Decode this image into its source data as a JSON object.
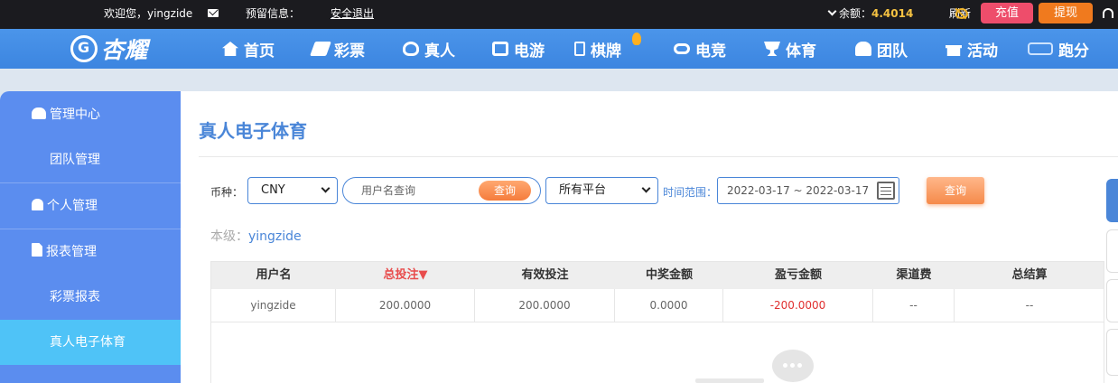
{
  "topbar": {
    "welcome": "欢迎您，yingzide",
    "message_label": "预留信息：",
    "logout": "安全退出",
    "balance_label": "余额：",
    "balance_value": "4.4014",
    "refresh": "刷新",
    "recharge": "充值",
    "withdraw": "提现"
  },
  "brand": {
    "name": "杏耀"
  },
  "nav": [
    {
      "label": "首页",
      "icon": "home-icon"
    },
    {
      "label": "彩票",
      "icon": "lottery-icon"
    },
    {
      "label": "真人",
      "icon": "live-dealer-icon"
    },
    {
      "label": "电游",
      "icon": "slot-machine-icon"
    },
    {
      "label": "棋牌",
      "icon": "chess-card-icon"
    },
    {
      "label": "电竞",
      "icon": "gamepad-icon"
    },
    {
      "label": "体育",
      "icon": "trophy-icon"
    },
    {
      "label": "团队",
      "icon": "team-icon"
    },
    {
      "label": "活动",
      "icon": "gift-icon"
    },
    {
      "label": "跑分",
      "icon": "run-points-icon"
    }
  ],
  "sidebar": [
    {
      "label": "管理中心",
      "type": "group",
      "icon": "team-icon"
    },
    {
      "label": "团队管理",
      "type": "sub"
    },
    {
      "label": "个人管理",
      "type": "group",
      "icon": "person-icon"
    },
    {
      "label": "报表管理",
      "type": "group",
      "icon": "report-icon"
    },
    {
      "label": "彩票报表",
      "type": "sub"
    },
    {
      "label": "真人电子体育",
      "type": "sub",
      "active": true
    }
  ],
  "page": {
    "title": "真人电子体育",
    "currency_label": "币种：",
    "currency_value": "CNY",
    "search_placeholder": "用户名查询",
    "search_button": "查询",
    "platform_value": "所有平台",
    "time_range_label": "时间范围：",
    "date_range": "2022-03-17 ~ 2022-03-17",
    "query_button": "查询",
    "level_label": "本级：",
    "level_user": "yingzide"
  },
  "table": {
    "headers": [
      "用户名",
      "总投注▼",
      "有效投注",
      "中奖金额",
      "盈亏金额",
      "渠道费",
      "总结算"
    ],
    "rows": [
      [
        "yingzide",
        "200.0000",
        "200.0000",
        "0.0000",
        "-200.0000",
        "--",
        "--"
      ]
    ]
  },
  "colors": {
    "topbar_bg": "#1b1b1f",
    "nav_bg": "#4a90e8",
    "sidebar_bg": "#5b8def",
    "sidebar_active": "#4fc3f7",
    "accent_orange": "#f58a4a",
    "recharge_bg": "#ee4d6b",
    "balance": "#f5c242",
    "negative": "#e03030"
  }
}
